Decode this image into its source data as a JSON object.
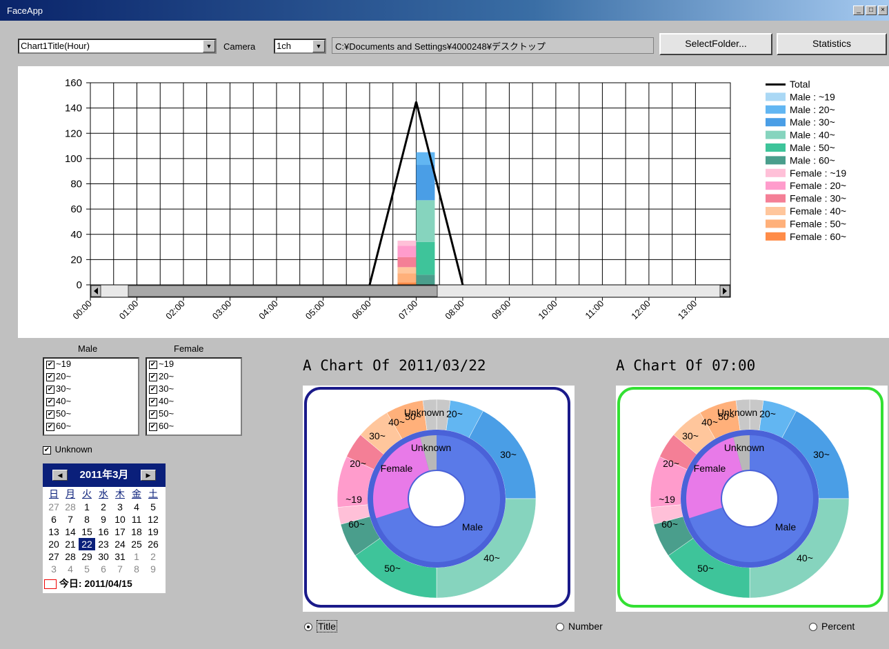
{
  "window": {
    "title": "FaceApp"
  },
  "toolbar": {
    "chart_select": "Chart1Title(Hour)",
    "camera_label": "Camera",
    "camera_select": "1ch",
    "folder_path": "C:¥Documents and Settings¥4000248¥デスクトップ",
    "select_folder_label": "SelectFolder...",
    "statistics_label": "Statistics"
  },
  "filters": {
    "male_title": "Male",
    "female_title": "Female",
    "age_items": [
      "~19",
      "20~",
      "30~",
      "40~",
      "50~",
      "60~"
    ],
    "unknown_label": "Unknown"
  },
  "calendar": {
    "month_label": "2011年3月",
    "dow": [
      "日",
      "月",
      "火",
      "水",
      "木",
      "金",
      "土"
    ],
    "weeks": [
      [
        "27",
        "28",
        "1",
        "2",
        "3",
        "4",
        "5"
      ],
      [
        "6",
        "7",
        "8",
        "9",
        "10",
        "11",
        "12"
      ],
      [
        "13",
        "14",
        "15",
        "16",
        "17",
        "18",
        "19"
      ],
      [
        "20",
        "21",
        "22",
        "23",
        "24",
        "25",
        "26"
      ],
      [
        "27",
        "28",
        "29",
        "30",
        "31",
        "1",
        "2"
      ],
      [
        "3",
        "4",
        "5",
        "6",
        "7",
        "8",
        "9"
      ]
    ],
    "today_label": "今日: 2011/04/15"
  },
  "donut_left": {
    "title": "A Chart Of 2011/03/22"
  },
  "donut_right": {
    "title": "A Chart Of 07:00"
  },
  "radios": {
    "title_label": "Title",
    "number_label": "Number",
    "percent_label": "Percent"
  },
  "colors": {
    "male_19": "#aad8f5",
    "male_20": "#62b6f2",
    "male_30": "#4a9ee6",
    "male_40": "#86d4be",
    "male_50": "#3ec49a",
    "male_60": "#4a9e8c",
    "female_19": "#ffc0d8",
    "female_20": "#ff9ccc",
    "female_30": "#f47f96",
    "female_40": "#ffc69c",
    "female_50": "#ffb07a",
    "female_60": "#ff8c48"
  },
  "chart_data": {
    "type": "bar",
    "title": "",
    "ylim": [
      0,
      160
    ],
    "yticks": [
      "0",
      "20",
      "40",
      "60",
      "80",
      "100",
      "120",
      "140",
      "160"
    ],
    "categories": [
      "00:00",
      "01:00",
      "02:00",
      "03:00",
      "04:00",
      "05:00",
      "06:00",
      "07:00",
      "08:00",
      "09:00",
      "10:00",
      "11:00",
      "12:00",
      "13:00"
    ],
    "legend": [
      "Total",
      "Male : ~19",
      "Male : 20~",
      "Male : 30~",
      "Male : 40~",
      "Male : 50~",
      "Male : 60~",
      "Female : ~19",
      "Female : 20~",
      "Female : 30~",
      "Female : 40~",
      "Female : 50~",
      "Female : 60~"
    ],
    "total_line": [
      0,
      0,
      0,
      0,
      0,
      0,
      0,
      145,
      0,
      0,
      0,
      0,
      0,
      0
    ],
    "stacks": [
      {
        "category": "07:00",
        "side": "female",
        "segments": [
          {
            "name": "Female : 60~",
            "value": 2
          },
          {
            "name": "Female : 50~",
            "value": 7
          },
          {
            "name": "Female : 40~",
            "value": 5
          },
          {
            "name": "Female : 30~",
            "value": 8
          },
          {
            "name": "Female : 20~",
            "value": 9
          },
          {
            "name": "Female : ~19",
            "value": 4
          }
        ]
      },
      {
        "category": "07:00",
        "side": "male",
        "segments": [
          {
            "name": "Male : 60~",
            "value": 8
          },
          {
            "name": "Male : 50~",
            "value": 26
          },
          {
            "name": "Male : 40~",
            "value": 33
          },
          {
            "name": "Male : 30~",
            "value": 28
          },
          {
            "name": "Male : 20~",
            "value": 10
          },
          {
            "name": "Male : ~19",
            "value": 0
          }
        ]
      }
    ]
  },
  "donut_labels": {
    "inner": [
      "Unknown",
      "Female",
      "Male"
    ],
    "outer": [
      "Unknown",
      "20~",
      "30~",
      "40~",
      "50~",
      "60~",
      "~19",
      "20~",
      "30~",
      "40~",
      "50~"
    ]
  }
}
